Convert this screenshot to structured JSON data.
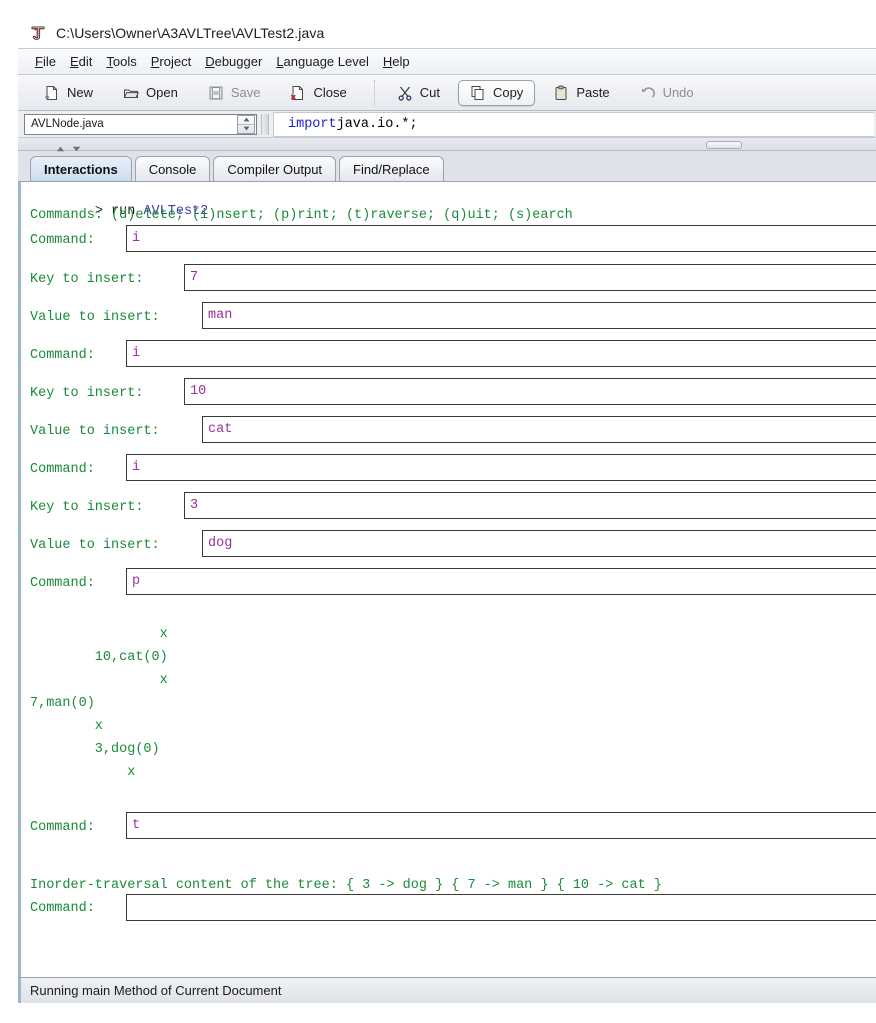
{
  "window": {
    "title": "C:\\Users\\Owner\\A3AVLTree\\AVLTest2.java",
    "icon": "drjava-j-icon"
  },
  "menubar": {
    "items": [
      {
        "mnemonic": "F",
        "rest": "ile"
      },
      {
        "mnemonic": "E",
        "rest": "dit"
      },
      {
        "mnemonic": "T",
        "rest": "ools"
      },
      {
        "mnemonic": "P",
        "rest": "roject"
      },
      {
        "mnemonic": "D",
        "rest": "ebugger"
      },
      {
        "mnemonic": "L",
        "rest": "anguage Level"
      },
      {
        "mnemonic": "H",
        "rest": "elp"
      }
    ]
  },
  "toolbar": {
    "buttons": [
      {
        "label": "New",
        "icon": "new-file-icon",
        "state": "normal"
      },
      {
        "label": "Open",
        "icon": "open-folder-icon",
        "state": "normal"
      },
      {
        "label": "Save",
        "icon": "save-disk-icon",
        "state": "disabled"
      },
      {
        "label": "Close",
        "icon": "close-file-icon",
        "state": "normal"
      },
      {
        "label": "Cut",
        "icon": "scissors-icon",
        "state": "normal"
      },
      {
        "label": "Copy",
        "icon": "copy-pages-icon",
        "state": "active"
      },
      {
        "label": "Paste",
        "icon": "clipboard-icon",
        "state": "normal"
      },
      {
        "label": "Undo",
        "icon": "undo-arrow-icon",
        "state": "disabled"
      }
    ]
  },
  "document_bar": {
    "selected_file": "AVLNode.java",
    "spinner_up_icon": "spinner-up-icon",
    "spinner_down_icon": "spinner-down-icon",
    "code_keyword": "import",
    "code_rest": " java.io.*;"
  },
  "split": {
    "up_arrow_icon": "scroll-up-arrow-icon",
    "down_arrow_icon": "scroll-down-arrow-icon",
    "grip_icon": "split-pane-grip"
  },
  "tabs": [
    {
      "label": "Interactions",
      "selected": true
    },
    {
      "label": "Console",
      "selected": false
    },
    {
      "label": "Compiler Output",
      "selected": false
    },
    {
      "label": "Find/Replace",
      "selected": false
    }
  ],
  "interactions": {
    "prompt": ">",
    "run_keyword": " run ",
    "run_class": "AVLTest2",
    "commands_line": "Commands: (d)elete; (i)nsert; (p)rint; (t)raverse; (q)uit; (s)earch",
    "label_command": "Command:",
    "label_key": "Key to insert:",
    "label_value": "Value to insert:",
    "entries": [
      {
        "label": "Command:",
        "value": "i"
      },
      {
        "label": "Key to insert:",
        "value": "7"
      },
      {
        "label": "Value to insert:",
        "value": "man"
      },
      {
        "label": "Command:",
        "value": "i"
      },
      {
        "label": "Key to insert:",
        "value": "10"
      },
      {
        "label": "Value to insert:",
        "value": "cat"
      },
      {
        "label": "Command:",
        "value": "i"
      },
      {
        "label": "Key to insert:",
        "value": "3"
      },
      {
        "label": "Value to insert:",
        "value": "dog"
      },
      {
        "label": "Command:",
        "value": "p"
      },
      {
        "label": "Command:",
        "value": "t"
      },
      {
        "label": "Command:",
        "value": ""
      }
    ],
    "tree_lines": [
      "                x",
      "        10,cat(0)",
      "                x",
      "7,man(0)",
      "        x",
      "        3,dog(0)",
      "            x"
    ],
    "traversal_line": "Inorder-traversal content of the tree: { 3 -> dog } { 7 -> man } { 10 -> cat }"
  },
  "statusbar": {
    "text": "Running main Method of Current Document"
  },
  "colors": {
    "green_text": "#1a8a3a",
    "input_text": "#99329a",
    "class_name": "#3b3bb5",
    "keyword": "#2222cc",
    "tab_selected": "#c9dcf0",
    "pane_border": "#9fb6cd"
  }
}
